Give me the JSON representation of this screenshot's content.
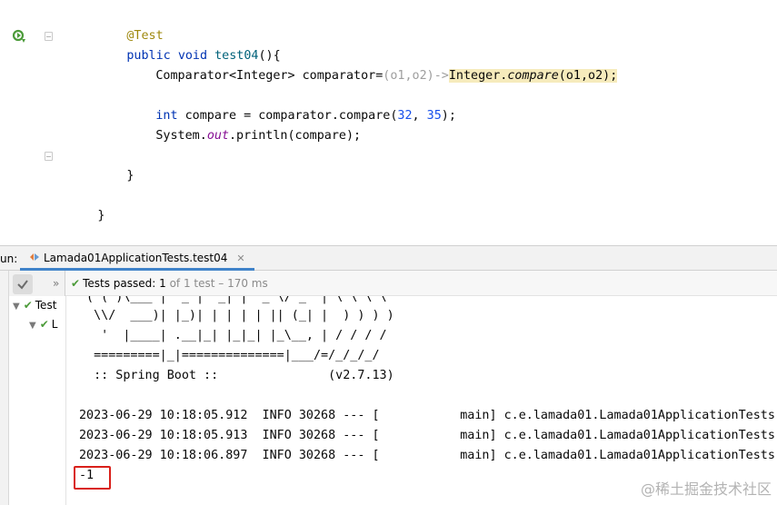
{
  "editor": {
    "lines": {
      "annotation": "@Test",
      "method_kw1": "public",
      "method_kw2": "void",
      "method_name": "test04",
      "method_rest": "(){",
      "comparator_decl": "Comparator<Integer> comparator=",
      "lambda_params": "(o1,o2)->",
      "lambda_class": "Integer.",
      "lambda_method": "compare",
      "lambda_args": "(o1,o2)",
      "lambda_end": ";",
      "int_kw": "int",
      "compare_assign": " compare = comparator.compare(",
      "num1": "32",
      "sep": ", ",
      "num2": "35",
      "compare_end": ");",
      "system_prefix": "System.",
      "system_out": "out",
      "system_suffix": ".println(compare);",
      "close_method": "}",
      "close_class": "}"
    }
  },
  "toolwindow": {
    "title": "un:",
    "tab_label": "Lamada01ApplicationTests.test04",
    "status_label": "Tests passed:",
    "status_count": "1",
    "status_rest": "of 1 test – 170 ms",
    "tree_root": "Test",
    "tree_child": "L"
  },
  "console": {
    "banner_top": " ( ( )\\___ | '_ | '_| | '_ \\/ _` | \\ \\ \\ \\",
    "banner_1": "  \\\\/  ___)| |_)| | | | | || (_| |  ) ) ) )",
    "banner_2": "   '  |____| .__|_| |_|_| |_\\__, | / / / /",
    "banner_3": "  =========|_|==============|___/=/_/_/_/",
    "banner_4": "  :: Spring Boot ::               (v2.7.13)",
    "log_1": "2023-06-29 10:18:05.912  INFO 30268 --- [           main] c.e.lamada01.Lamada01ApplicationTests",
    "log_2": "2023-06-29 10:18:05.913  INFO 30268 --- [           main] c.e.lamada01.Lamada01ApplicationTests",
    "log_3": "2023-06-29 10:18:06.897  INFO 30268 --- [           main] c.e.lamada01.Lamada01ApplicationTests",
    "result": "-1"
  },
  "watermark": "@稀土掘金技术社区",
  "colors": {
    "accent": "#4083c9",
    "pass_green": "#4c9b3a",
    "result_box": "#d9201a",
    "keyword": "#0033b3",
    "annotation": "#9e880d"
  }
}
